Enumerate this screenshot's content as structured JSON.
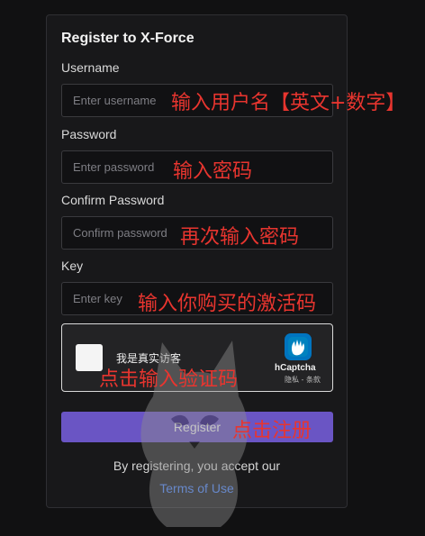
{
  "form": {
    "title": "Register to X-Force",
    "username": {
      "label": "Username",
      "placeholder": "Enter username"
    },
    "password": {
      "label": "Password",
      "placeholder": "Enter password"
    },
    "confirm_password": {
      "label": "Confirm Password",
      "placeholder": "Confirm password"
    },
    "key": {
      "label": "Key",
      "placeholder": "Enter key"
    },
    "captcha": {
      "checkbox_text": "我是真实访客",
      "brand": "hCaptcha",
      "links": "隐私 - 条款"
    },
    "register_button": "Register",
    "accept_text": "By registering, you accept our",
    "terms_link": "Terms of Use"
  },
  "annotations": {
    "username": "输入用户名【英文+数字】",
    "password": "输入密码",
    "confirm_password": "再次输入密码",
    "key": "输入你购买的激活码",
    "captcha": "点击输入验证码",
    "register": "点击注册"
  },
  "colors": {
    "background": "#111112",
    "card": "#18181a",
    "button": "#6a55c4",
    "link": "#4a86ff",
    "annotation": "#e8352f"
  }
}
